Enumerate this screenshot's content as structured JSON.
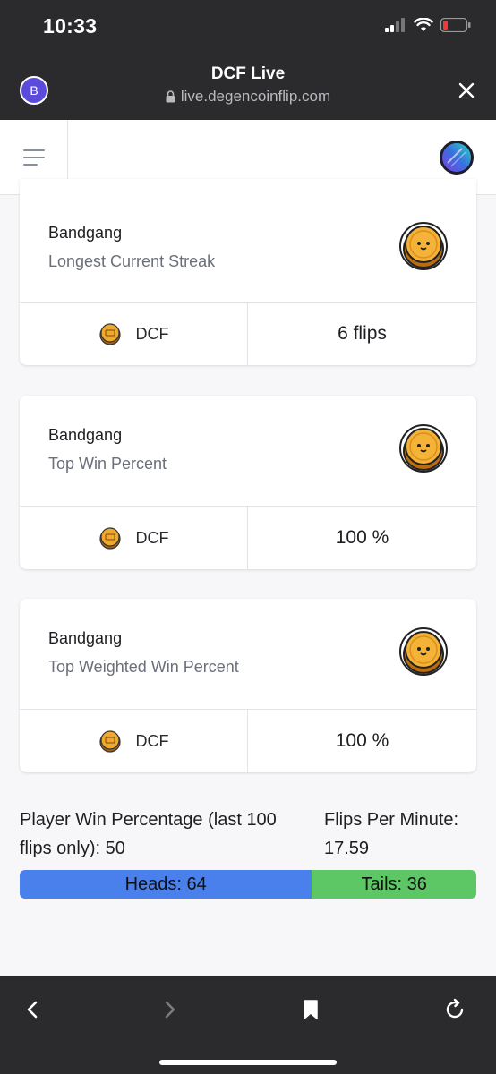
{
  "status_bar": {
    "time": "10:33"
  },
  "browser": {
    "avatar_initial": "B",
    "title": "DCF Live",
    "url": "live.degencoinflip.com"
  },
  "cards": [
    {
      "name": "Bandgang",
      "subtitle": "Longest Current Streak",
      "token": "DCF",
      "value": "6 flips"
    },
    {
      "name": "Bandgang",
      "subtitle": "Top Win Percent",
      "token": "DCF",
      "value": "100 %"
    },
    {
      "name": "Bandgang",
      "subtitle": "Top Weighted Win Percent",
      "token": "DCF",
      "value": "100 %"
    }
  ],
  "stats": {
    "player_win_percentage": "Player Win Percentage (last 100 flips only): 50",
    "flips_per_minute": "Flips Per Minute: 17.59"
  },
  "ratio": {
    "heads_label": "Heads: 64",
    "tails_label": "Tails: 36",
    "heads_fraction": 0.64,
    "heads_color": "#4a80ec",
    "tails_color": "#5cc764"
  },
  "icons": {
    "close": "close-icon",
    "menu": "hamburger-menu-icon",
    "back": "chevron-left-icon",
    "forward": "chevron-right-icon",
    "bookmark": "bookmark-icon",
    "reload": "reload-icon",
    "coin": "smiling-coin-icon"
  }
}
